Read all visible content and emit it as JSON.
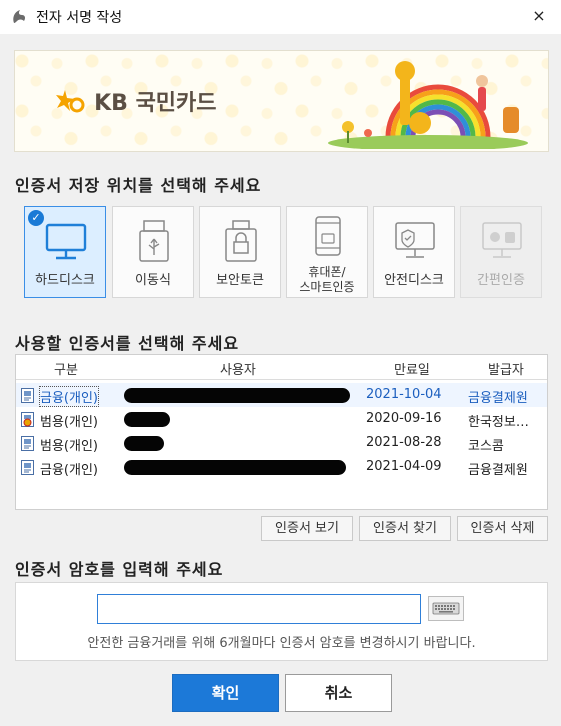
{
  "window": {
    "title": "전자 서명 작성",
    "close_icon": "×"
  },
  "banner": {
    "logo_text": "KB 국민카드",
    "brand_color": "#f5a300"
  },
  "storage_section": {
    "title": "인증서 저장 위치를 선택해 주세요",
    "items": [
      {
        "label": "하드디스크",
        "icon": "monitor-icon",
        "selected": true,
        "disabled": false
      },
      {
        "label": "이동식",
        "icon": "usb-icon",
        "selected": false,
        "disabled": false
      },
      {
        "label": "보안토큰",
        "icon": "token-lock-icon",
        "selected": false,
        "disabled": false
      },
      {
        "label_line1": "휴대폰/",
        "label_line2": "스마트인증",
        "icon": "phone-icon",
        "selected": false,
        "disabled": false
      },
      {
        "label": "안전디스크",
        "icon": "secure-disk-icon",
        "selected": false,
        "disabled": false
      },
      {
        "label": "간편인증",
        "icon": "apple-android-icon",
        "selected": false,
        "disabled": true
      }
    ]
  },
  "cert_section": {
    "title": "사용할 인증서를 선택해 주세요",
    "columns": [
      "구분",
      "사용자",
      "만료일",
      "발급자"
    ],
    "rows": [
      {
        "type": "금융(개인)",
        "expiry": "2021-10-04",
        "issuer": "금융결제원",
        "icon": "certificate-icon",
        "selected": true
      },
      {
        "type": "범용(개인)",
        "expiry": "2020-09-16",
        "issuer": "한국정보…",
        "icon": "certificate-warning-icon",
        "selected": false
      },
      {
        "type": "범용(개인)",
        "expiry": "2021-08-28",
        "issuer": "코스콤",
        "icon": "certificate-icon",
        "selected": false
      },
      {
        "type": "금융(개인)",
        "expiry": "2021-04-09",
        "issuer": "금융결제원",
        "icon": "certificate-icon",
        "selected": false
      }
    ],
    "buttons": {
      "view": "인증서 보기",
      "find": "인증서 찾기",
      "delete": "인증서 삭제"
    }
  },
  "password_section": {
    "title": "인증서 암호를 입력해 주세요",
    "value": "",
    "keyboard_icon": "keyboard-icon",
    "notice": "안전한 금융거래를 위해 6개월마다 인증서 암호를 변경하시기 바랍니다."
  },
  "actions": {
    "ok": "확인",
    "cancel": "취소",
    "ok_color": "#1c79d8"
  }
}
